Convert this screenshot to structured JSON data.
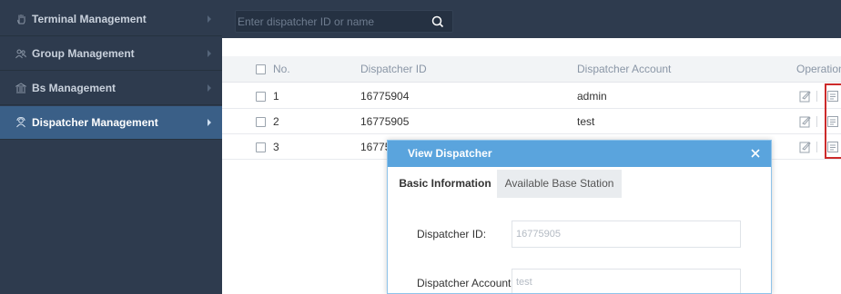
{
  "sidebar": {
    "items": [
      {
        "label": "Terminal Management",
        "icon": "hand-icon",
        "active": false
      },
      {
        "label": "Group Management",
        "icon": "group-icon",
        "active": false
      },
      {
        "label": "Bs Management",
        "icon": "base-station-icon",
        "active": false
      },
      {
        "label": "Dispatcher Management",
        "icon": "dispatcher-icon",
        "active": true
      }
    ]
  },
  "search": {
    "placeholder": "Enter dispatcher ID or name",
    "value": ""
  },
  "table": {
    "columns": {
      "no": "No.",
      "dispatcher_id": "Dispatcher ID",
      "dispatcher_account": "Dispatcher Account",
      "operation": "Operation"
    },
    "rows": [
      {
        "no": "1",
        "dispatcher_id": "16775904",
        "account": "admin"
      },
      {
        "no": "2",
        "dispatcher_id": "16775905",
        "account": "test"
      },
      {
        "no": "3",
        "dispatcher_id": "16775",
        "account": ""
      }
    ]
  },
  "dialog": {
    "title": "View Dispatcher",
    "tabs": [
      {
        "label": "Basic Information",
        "active": true
      },
      {
        "label": "Available Base Station",
        "active": false
      }
    ],
    "fields": {
      "dispatcher_id_label": "Dispatcher ID:",
      "dispatcher_id_value": "16775905",
      "dispatcher_account_label": "Dispatcher Account:",
      "dispatcher_account_value": "test"
    }
  },
  "colors": {
    "sidebar_bg": "#2e3b4e",
    "sidebar_active": "#3a5f87",
    "dialog_header": "#5aa4dd",
    "highlight_box": "#cc2a2a"
  }
}
